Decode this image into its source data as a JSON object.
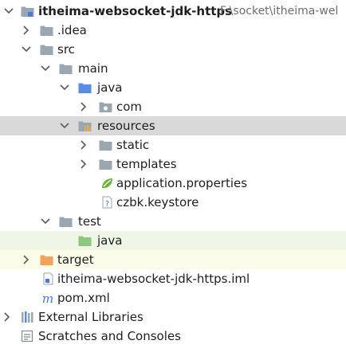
{
  "project": {
    "name": "itheima-websocket-jdk-https",
    "path": "F:\\socket\\itheima-wel"
  },
  "tree": {
    "idea": ".idea",
    "src": "src",
    "main": "main",
    "main_java": "java",
    "com": "com",
    "resources": "resources",
    "static": "static",
    "templates": "templates",
    "app_props": "application.properties",
    "keystore": "czbk.keystore",
    "test": "test",
    "test_java": "java",
    "target": "target",
    "iml": "itheima-websocket-jdk-https.iml",
    "pom": "pom.xml",
    "external_libraries": "External Libraries",
    "scratches": "Scratches and Consoles"
  },
  "colors": {
    "folder": "#9aa7b0",
    "source_folder": "#5a8de0",
    "test_source_folder": "#8ec77e",
    "excluded_folder": "#f2a25a",
    "resources_folder": "#9aa7b0",
    "spring_leaf": "#6db33f",
    "maven_m": "#4a7bd4",
    "selected_row": "#d9d9d9",
    "test_row": "#eff6e6",
    "excluded_row": "#fbfbe9"
  },
  "icons": {
    "project": "module-folder-icon",
    "folder": "folder-icon",
    "package": "package-icon",
    "properties": "spring-properties-icon",
    "unknown_file": "unknown-file-icon",
    "iml": "module-file-icon",
    "maven": "maven-icon",
    "libraries": "libraries-icon",
    "scratches": "scratches-icon"
  }
}
